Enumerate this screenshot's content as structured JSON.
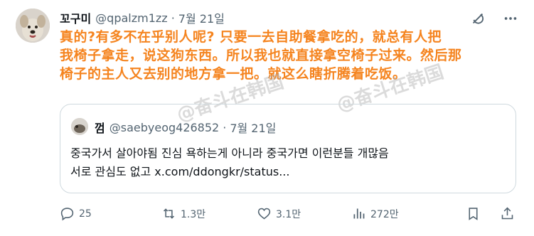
{
  "tweet": {
    "author_name": "꼬구미",
    "handle": "@qpalzm1zz",
    "separator": "·",
    "date": "7월 21일",
    "text_lines": [
      "真的?有多不在乎别人呢? 只要一去自助餐拿吃的，就总有人把",
      "我椅子拿走，说这狗东西。所以我也就直接拿空椅子过来。然后那",
      "椅子的主人又去别的地方拿一把。就这么瞎折腾着吃饭。"
    ]
  },
  "quote": {
    "author_name": "껌",
    "handle": "@saebyeog426852",
    "separator": "·",
    "date": "7월 21일",
    "text_lines": [
      "중국가서 살아야됨 진심 욕하는게 아니라 중국가면 이런분들 개많음",
      "서로 관심도 없고 x.com/ddongkr/status..."
    ]
  },
  "actions": {
    "reply_count": "25",
    "retweet_count": "1.3만",
    "like_count": "3.1만",
    "view_count": "272만"
  },
  "watermark": {
    "text_a": "@奋斗在韩国",
    "text_b": "@奋斗在韩国"
  },
  "colors": {
    "overlay_text": "#f5841f",
    "secondary_text": "#536471",
    "border": "#cfd9de"
  },
  "icons": [
    "grok-icon",
    "more-icon",
    "reply-icon",
    "retweet-icon",
    "like-icon",
    "views-icon",
    "bookmark-icon",
    "share-icon"
  ]
}
